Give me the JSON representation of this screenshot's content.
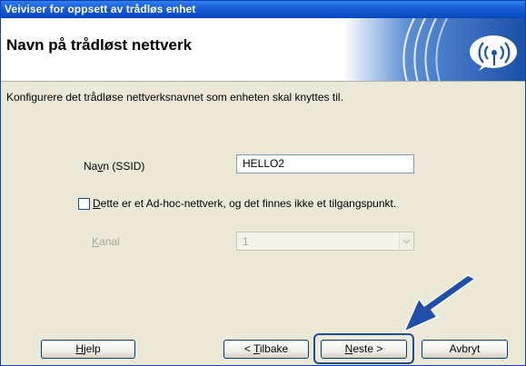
{
  "window": {
    "title": "Veiviser for oppsett av trådløs enhet"
  },
  "header": {
    "title": "Navn på trådløst nettverk",
    "graphic_icon": "wireless-signal-icon"
  },
  "instruction": "Konfigurere det trådløse nettverksnavnet som enheten skal knyttes til.",
  "form": {
    "ssid_label_prefix": "Na",
    "ssid_label_mnemonic": "v",
    "ssid_label_suffix": "n (SSID)",
    "ssid_value": "HELLO2",
    "adhoc_checked": false,
    "adhoc_label_mnemonic": "D",
    "adhoc_label_rest": "ette er et Ad-hoc-nettverk, og det finnes ikke et tilgangspunkt.",
    "channel_label_mnemonic": "K",
    "channel_label_rest": "anal",
    "channel_value": "1",
    "channel_enabled": false
  },
  "buttons": {
    "help_mnemonic": "H",
    "help_rest": "jelp",
    "back_prefix": "< ",
    "back_mnemonic": "T",
    "back_rest": "ilbake",
    "next_mnemonic": "N",
    "next_rest": "este >",
    "cancel": "Avbryt"
  },
  "colors": {
    "titlebar": "#0d4fc9",
    "window_bg": "#ece9d8",
    "highlight": "#1e4aa0",
    "arrow": "#1f4fa8"
  }
}
